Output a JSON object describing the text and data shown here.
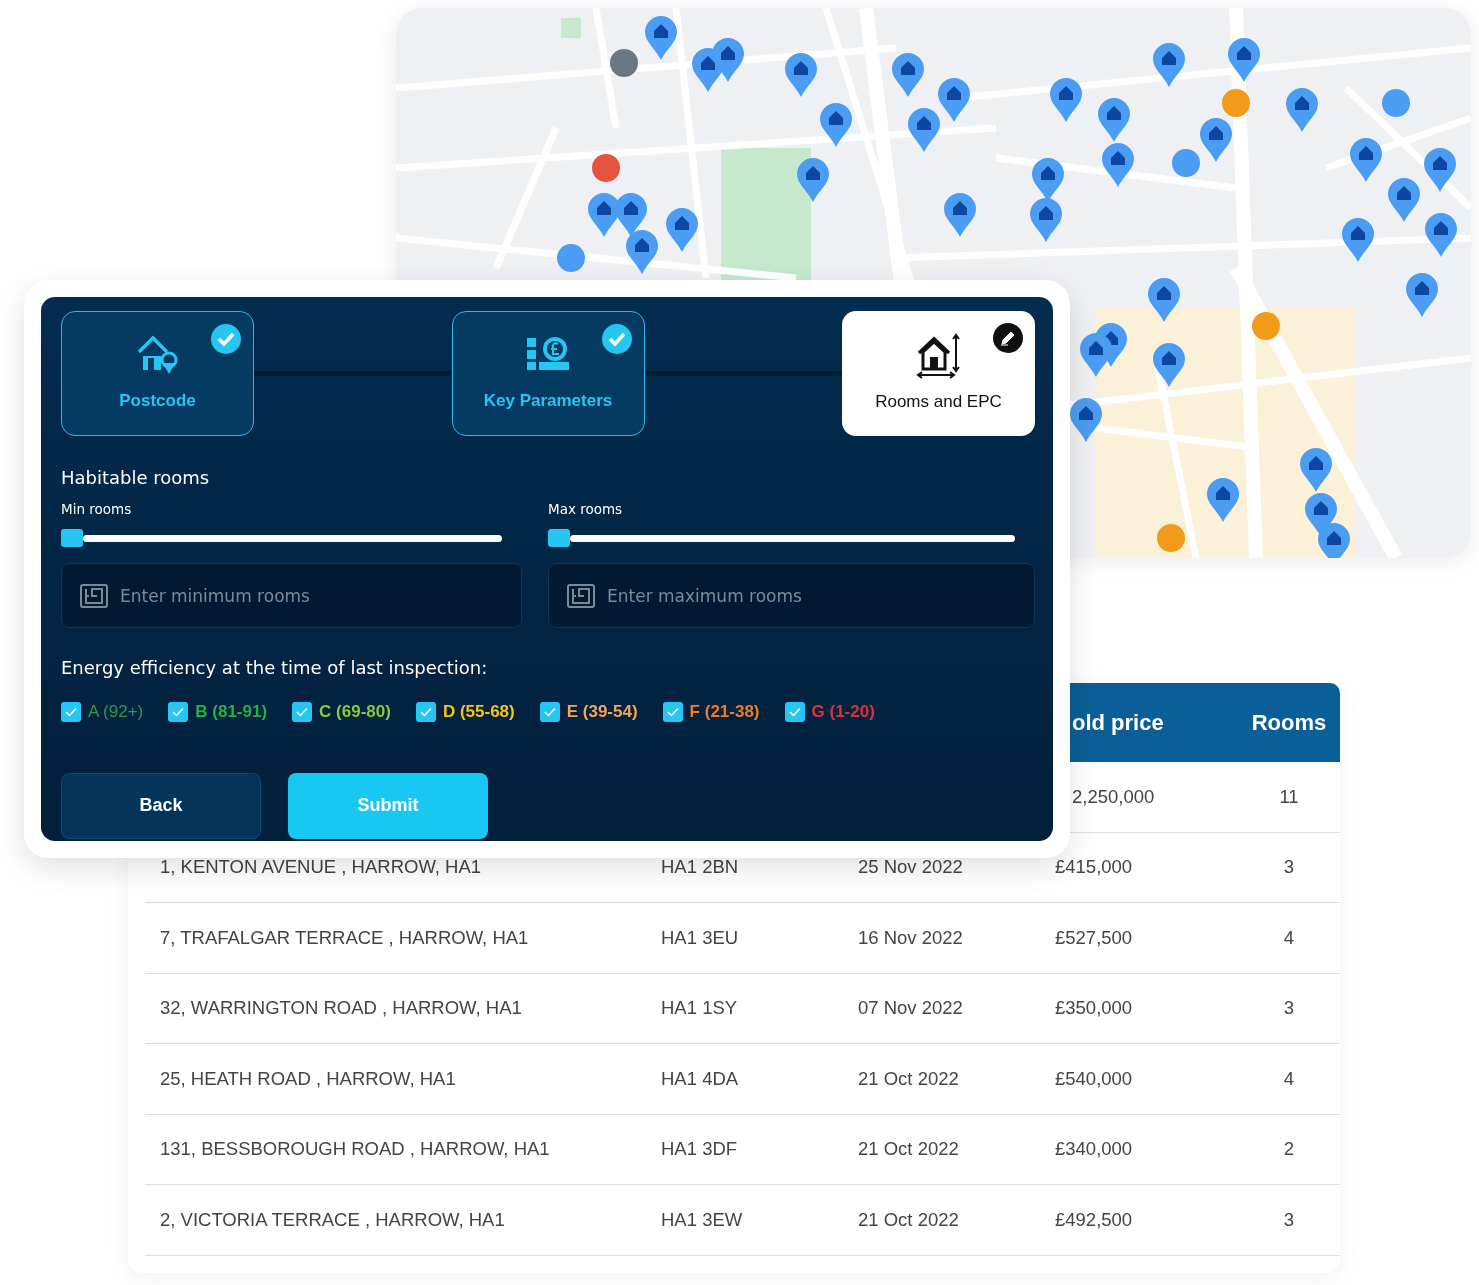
{
  "map": {
    "kind": "street-map"
  },
  "form": {
    "steps": [
      {
        "label": "Postcode",
        "selected": false,
        "completed": true
      },
      {
        "label": "Key Parameters",
        "selected": false,
        "completed": true
      },
      {
        "label": "Rooms and EPC",
        "selected": true,
        "completed": false
      }
    ],
    "rooms_heading": "Habitable rooms",
    "ranges": [
      {
        "label": "Min rooms",
        "level": 0,
        "placeholder": "Enter minimum rooms"
      },
      {
        "label": "Max rooms",
        "level": 0,
        "placeholder": "Enter maximum rooms"
      }
    ],
    "energy_heading": "Energy efficiency at the time of last inspection:",
    "bands": [
      {
        "label": "A (92+)",
        "color": "#2e9a4e",
        "checked": true
      },
      {
        "label": "B (81-91)",
        "color": "#1fb24a",
        "checked": true
      },
      {
        "label": "C (69-80)",
        "color": "#8cc63f",
        "checked": true
      },
      {
        "label": "D (55-68)",
        "color": "#f5c518",
        "checked": true
      },
      {
        "label": "E (39-54)",
        "color": "#f7a35c",
        "checked": true
      },
      {
        "label": "F (21-38)",
        "color": "#f47b20",
        "checked": true
      },
      {
        "label": "G (1-20)",
        "color": "#e0303a",
        "checked": true
      }
    ],
    "buttons": [
      {
        "label": "Back",
        "kind": "secondary"
      },
      {
        "label": "Submit",
        "kind": "primary"
      }
    ]
  },
  "table": {
    "columns": [
      {
        "label": "old price"
      },
      {
        "label": "Rooms"
      }
    ],
    "rows": [
      {
        "price": "2,250,000",
        "rooms": "11"
      },
      {
        "address": "1, KENTON AVENUE , HARROW, HA1",
        "postcode": "HA1 2BN",
        "date": "25 Nov 2022",
        "price": "£415,000",
        "rooms": "3"
      },
      {
        "address": "7, TRAFALGAR TERRACE , HARROW, HA1",
        "postcode": "HA1 3EU",
        "date": "16 Nov 2022",
        "price": "£527,500",
        "rooms": "4"
      },
      {
        "address": "32, WARRINGTON ROAD , HARROW, HA1",
        "postcode": "HA1 1SY",
        "date": "07 Nov 2022",
        "price": "£350,000",
        "rooms": "3"
      },
      {
        "address": "25, HEATH ROAD , HARROW, HA1",
        "postcode": "HA1 4DA",
        "date": "21 Oct 2022",
        "price": "£540,000",
        "rooms": "4"
      },
      {
        "address": "131, BESSBOROUGH ROAD , HARROW, HA1",
        "postcode": "HA1 3DF",
        "date": "21 Oct 2022",
        "price": "£340,000",
        "rooms": "2"
      },
      {
        "address": "2, VICTORIA TERRACE , HARROW, HA1",
        "postcode": "HA1 3EW",
        "date": "21 Oct 2022",
        "price": "£492,500",
        "rooms": "3"
      }
    ]
  }
}
